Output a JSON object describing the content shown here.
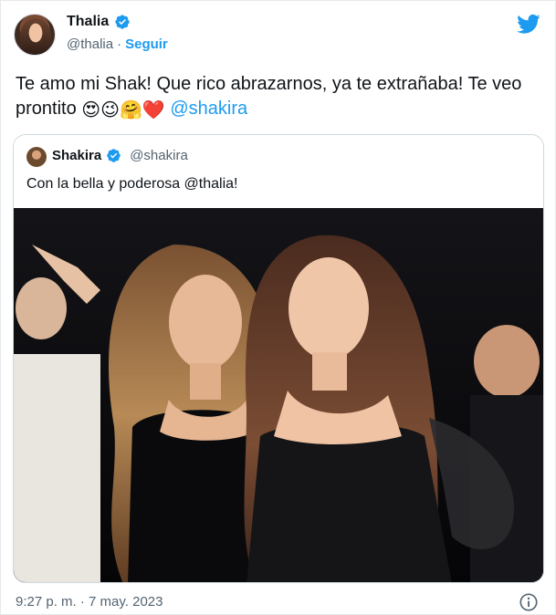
{
  "author": {
    "display_name": "Thalia",
    "handle": "@thalia",
    "separator": "·",
    "follow_label": "Seguir"
  },
  "tweet": {
    "text_part1": "Te amo mi Shak! Que rico abrazarnos, ya te extrañaba! Te veo prontito ",
    "emojis": [
      "😍",
      "😉",
      "🤗",
      "❤️"
    ],
    "mention": "@shakira"
  },
  "quoted": {
    "display_name": "Shakira",
    "handle": "@shakira",
    "text": "Con la bella y poderosa @thalia!"
  },
  "footer": {
    "timestamp": "9:27 p. m. · 7 may. 2023"
  },
  "icons": {
    "verified": "verified-badge-icon",
    "brand": "twitter-bird-icon",
    "info": "info-icon"
  },
  "colors": {
    "accent": "#1d9bf0",
    "text": "#0f1419",
    "secondary_text": "#536471",
    "border": "#cfd9de"
  }
}
